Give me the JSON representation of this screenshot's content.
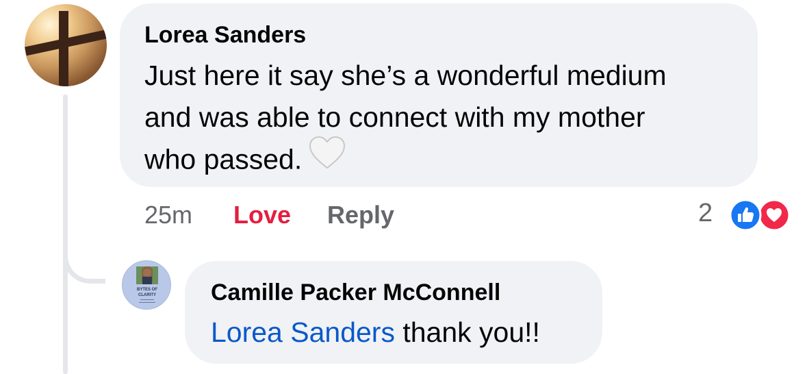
{
  "comment": {
    "author": "Lorea Sanders",
    "text_lines": [
      "Just here it say she’s a wonderful medium",
      "and was able to connect with my mother",
      "who passed."
    ],
    "emoji": "white-heart-icon",
    "actions": {
      "time": "25m",
      "love_label": "Love",
      "reply_label": "Reply"
    },
    "reaction_count": "2",
    "reactions": [
      "like-reaction-icon",
      "love-reaction-icon"
    ]
  },
  "reply": {
    "author": "Camille Packer McConnell",
    "mention": "Lorea Sanders",
    "text": " thank you!!",
    "avatar_text": [
      "BYTES OF",
      "CLARITY"
    ]
  },
  "colors": {
    "bubble": "#f0f2f5",
    "love": "#e41e3f",
    "mention": "#0a58ca",
    "like_blue": "#1877f2",
    "love_red": "#f02849",
    "muted": "#65676b"
  }
}
